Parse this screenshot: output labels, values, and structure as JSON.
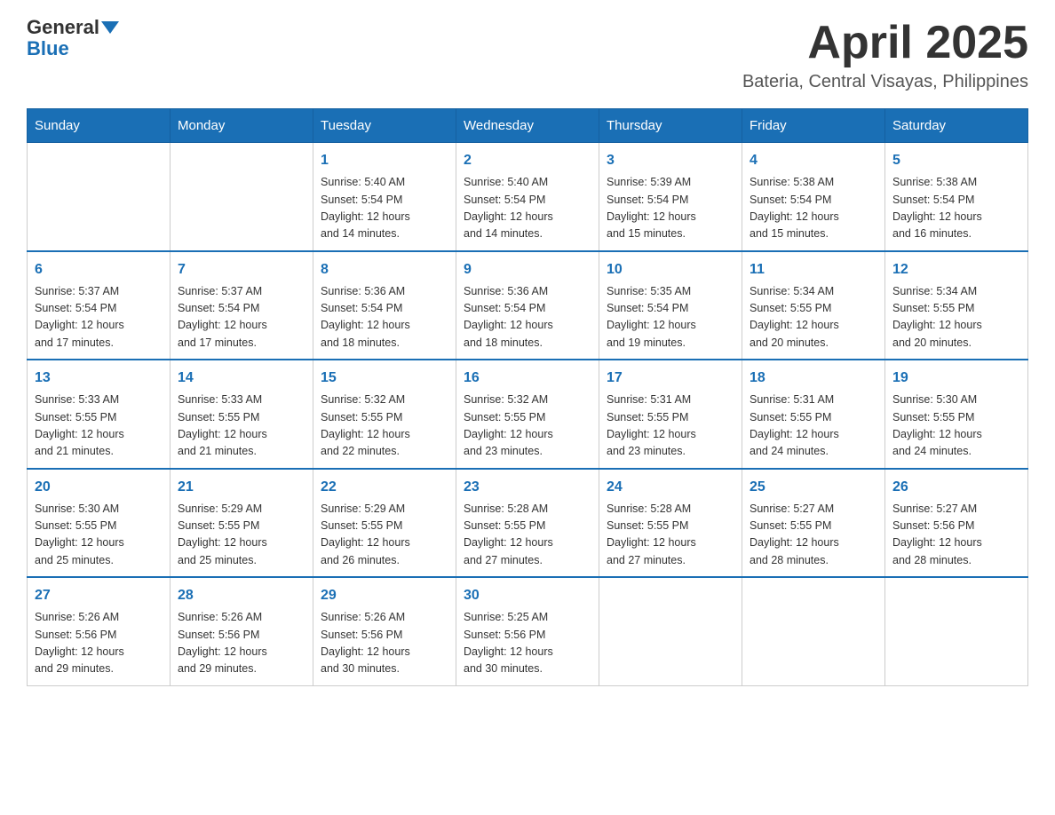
{
  "header": {
    "logo_general": "General",
    "logo_blue": "Blue",
    "month_year": "April 2025",
    "location": "Bateria, Central Visayas, Philippines"
  },
  "weekdays": [
    "Sunday",
    "Monday",
    "Tuesday",
    "Wednesday",
    "Thursday",
    "Friday",
    "Saturday"
  ],
  "weeks": [
    [
      {
        "day": "",
        "info": ""
      },
      {
        "day": "",
        "info": ""
      },
      {
        "day": "1",
        "info": "Sunrise: 5:40 AM\nSunset: 5:54 PM\nDaylight: 12 hours\nand 14 minutes."
      },
      {
        "day": "2",
        "info": "Sunrise: 5:40 AM\nSunset: 5:54 PM\nDaylight: 12 hours\nand 14 minutes."
      },
      {
        "day": "3",
        "info": "Sunrise: 5:39 AM\nSunset: 5:54 PM\nDaylight: 12 hours\nand 15 minutes."
      },
      {
        "day": "4",
        "info": "Sunrise: 5:38 AM\nSunset: 5:54 PM\nDaylight: 12 hours\nand 15 minutes."
      },
      {
        "day": "5",
        "info": "Sunrise: 5:38 AM\nSunset: 5:54 PM\nDaylight: 12 hours\nand 16 minutes."
      }
    ],
    [
      {
        "day": "6",
        "info": "Sunrise: 5:37 AM\nSunset: 5:54 PM\nDaylight: 12 hours\nand 17 minutes."
      },
      {
        "day": "7",
        "info": "Sunrise: 5:37 AM\nSunset: 5:54 PM\nDaylight: 12 hours\nand 17 minutes."
      },
      {
        "day": "8",
        "info": "Sunrise: 5:36 AM\nSunset: 5:54 PM\nDaylight: 12 hours\nand 18 minutes."
      },
      {
        "day": "9",
        "info": "Sunrise: 5:36 AM\nSunset: 5:54 PM\nDaylight: 12 hours\nand 18 minutes."
      },
      {
        "day": "10",
        "info": "Sunrise: 5:35 AM\nSunset: 5:54 PM\nDaylight: 12 hours\nand 19 minutes."
      },
      {
        "day": "11",
        "info": "Sunrise: 5:34 AM\nSunset: 5:55 PM\nDaylight: 12 hours\nand 20 minutes."
      },
      {
        "day": "12",
        "info": "Sunrise: 5:34 AM\nSunset: 5:55 PM\nDaylight: 12 hours\nand 20 minutes."
      }
    ],
    [
      {
        "day": "13",
        "info": "Sunrise: 5:33 AM\nSunset: 5:55 PM\nDaylight: 12 hours\nand 21 minutes."
      },
      {
        "day": "14",
        "info": "Sunrise: 5:33 AM\nSunset: 5:55 PM\nDaylight: 12 hours\nand 21 minutes."
      },
      {
        "day": "15",
        "info": "Sunrise: 5:32 AM\nSunset: 5:55 PM\nDaylight: 12 hours\nand 22 minutes."
      },
      {
        "day": "16",
        "info": "Sunrise: 5:32 AM\nSunset: 5:55 PM\nDaylight: 12 hours\nand 23 minutes."
      },
      {
        "day": "17",
        "info": "Sunrise: 5:31 AM\nSunset: 5:55 PM\nDaylight: 12 hours\nand 23 minutes."
      },
      {
        "day": "18",
        "info": "Sunrise: 5:31 AM\nSunset: 5:55 PM\nDaylight: 12 hours\nand 24 minutes."
      },
      {
        "day": "19",
        "info": "Sunrise: 5:30 AM\nSunset: 5:55 PM\nDaylight: 12 hours\nand 24 minutes."
      }
    ],
    [
      {
        "day": "20",
        "info": "Sunrise: 5:30 AM\nSunset: 5:55 PM\nDaylight: 12 hours\nand 25 minutes."
      },
      {
        "day": "21",
        "info": "Sunrise: 5:29 AM\nSunset: 5:55 PM\nDaylight: 12 hours\nand 25 minutes."
      },
      {
        "day": "22",
        "info": "Sunrise: 5:29 AM\nSunset: 5:55 PM\nDaylight: 12 hours\nand 26 minutes."
      },
      {
        "day": "23",
        "info": "Sunrise: 5:28 AM\nSunset: 5:55 PM\nDaylight: 12 hours\nand 27 minutes."
      },
      {
        "day": "24",
        "info": "Sunrise: 5:28 AM\nSunset: 5:55 PM\nDaylight: 12 hours\nand 27 minutes."
      },
      {
        "day": "25",
        "info": "Sunrise: 5:27 AM\nSunset: 5:55 PM\nDaylight: 12 hours\nand 28 minutes."
      },
      {
        "day": "26",
        "info": "Sunrise: 5:27 AM\nSunset: 5:56 PM\nDaylight: 12 hours\nand 28 minutes."
      }
    ],
    [
      {
        "day": "27",
        "info": "Sunrise: 5:26 AM\nSunset: 5:56 PM\nDaylight: 12 hours\nand 29 minutes."
      },
      {
        "day": "28",
        "info": "Sunrise: 5:26 AM\nSunset: 5:56 PM\nDaylight: 12 hours\nand 29 minutes."
      },
      {
        "day": "29",
        "info": "Sunrise: 5:26 AM\nSunset: 5:56 PM\nDaylight: 12 hours\nand 30 minutes."
      },
      {
        "day": "30",
        "info": "Sunrise: 5:25 AM\nSunset: 5:56 PM\nDaylight: 12 hours\nand 30 minutes."
      },
      {
        "day": "",
        "info": ""
      },
      {
        "day": "",
        "info": ""
      },
      {
        "day": "",
        "info": ""
      }
    ]
  ]
}
